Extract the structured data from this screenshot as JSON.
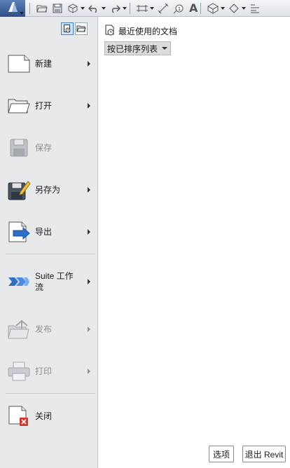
{
  "toolbar": {
    "icons": [
      "revit-app-icon",
      "open-icon",
      "save-icon",
      "sync-icon",
      "undo-icon",
      "redo-icon",
      "measure-icon",
      "dimension-icon",
      "tag-icon",
      "text-icon",
      "3d-view-icon",
      "section-icon",
      "thin-lines-icon"
    ],
    "text_tool_label": "A"
  },
  "menu": {
    "items": [
      {
        "label": "新建",
        "icon": "new-document-icon",
        "has_submenu": true,
        "enabled": true
      },
      {
        "label": "打开",
        "icon": "open-folder-icon",
        "has_submenu": true,
        "enabled": true
      },
      {
        "label": "保存",
        "icon": "save-disk-icon",
        "has_submenu": false,
        "enabled": false
      },
      {
        "label": "另存为",
        "icon": "save-as-icon",
        "has_submenu": true,
        "enabled": true
      },
      {
        "label": "导出",
        "icon": "export-icon",
        "has_submenu": true,
        "enabled": true
      },
      {
        "label": "Suite 工作流",
        "icon": "suite-workflow-icon",
        "has_submenu": true,
        "enabled": true
      },
      {
        "label": "发布",
        "icon": "publish-icon",
        "has_submenu": true,
        "enabled": false
      },
      {
        "label": "打印",
        "icon": "print-icon",
        "has_submenu": true,
        "enabled": false
      },
      {
        "label": "关闭",
        "icon": "close-document-icon",
        "has_submenu": false,
        "enabled": true
      }
    ]
  },
  "recent": {
    "title": "最近使用的文档",
    "sort_selected": "按已排序列表"
  },
  "footer": {
    "options_label": "选项",
    "exit_label": "退出 Revit"
  },
  "colors": {
    "menu_bg": "#e8e9eb",
    "panel_bg": "#ffffff",
    "accent_blue": "#2f6fc9",
    "close_red": "#d33a2c"
  }
}
